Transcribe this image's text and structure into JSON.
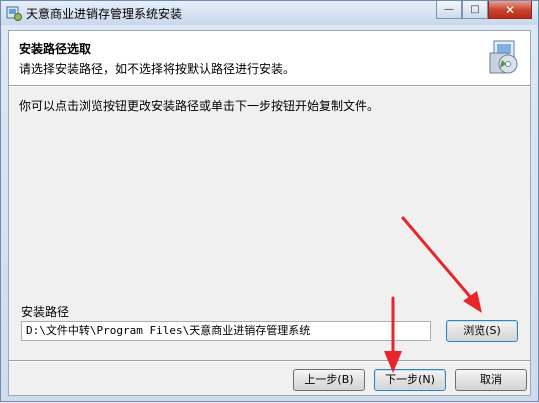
{
  "window": {
    "title": "天意商业进销存管理系统安装",
    "minimize_glyph": "—",
    "maximize_glyph": "□",
    "close_glyph": "✕",
    "icon": "installer-icon"
  },
  "header": {
    "title": "安装路径选取",
    "subtitle": "请选择安装路径，如不选择将按默认路径进行安装。",
    "icon": "setup-cd-icon"
  },
  "body": {
    "instruction": "你可以点击浏览按钮更改安装路径或单击下一步按钮开始复制文件。",
    "path_label": "安装路径",
    "path_value": "D:\\文件中转\\Program Files\\天意商业进销存管理系统",
    "browse_label": "浏览(S)"
  },
  "footer": {
    "prev_label": "上一步(B)",
    "next_label": "下一步(N)",
    "cancel_label": "取消"
  },
  "annotation": {
    "arrow_color": "#e8262a"
  }
}
